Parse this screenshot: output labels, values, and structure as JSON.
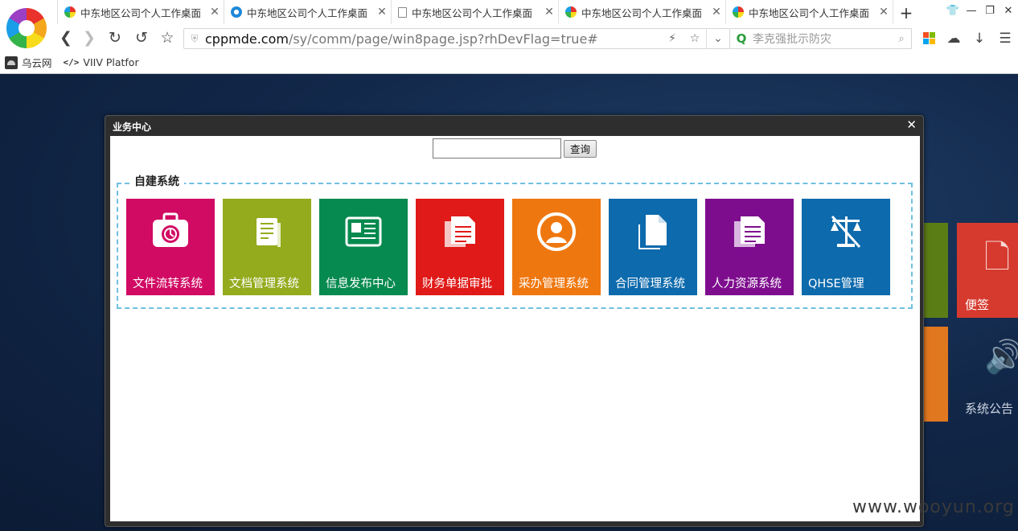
{
  "browser": {
    "tabs": [
      {
        "label": "中东地区公司个人工作桌面",
        "icon": "color",
        "active": true
      },
      {
        "label": "中东地区公司个人工作桌面",
        "icon": "blue"
      },
      {
        "label": "中东地区公司个人工作桌面",
        "icon": "doc"
      },
      {
        "label": "中东地区公司个人工作桌面",
        "icon": "color"
      },
      {
        "label": "中东地区公司个人工作桌面",
        "icon": "color"
      }
    ],
    "url_domain": "cppmde.com",
    "url_path": "/sy/comm/page/win8page.jsp?rhDevFlag=true#",
    "search_placeholder": "李克强批示防灾",
    "bookmarks": [
      {
        "label": "乌云网",
        "icon": "wooyun-icon"
      },
      {
        "label": "VIIV Platfor",
        "icon": "code-icon"
      }
    ]
  },
  "background_tiles": [
    {
      "label": "便签",
      "color": "#d63a2f"
    },
    {
      "label": "系统公告",
      "color": "#e0781f"
    }
  ],
  "dialog": {
    "title": "业务中心",
    "close_glyph": "✕",
    "search": {
      "value": "",
      "button_label": "查询"
    },
    "section": {
      "legend": "自建系统",
      "tiles": [
        {
          "label": "文件流转系统",
          "color": "#d10a63",
          "icon": "briefcase-icon"
        },
        {
          "label": "文档管理系统",
          "color": "#93ab1d",
          "icon": "document-icon"
        },
        {
          "label": "信息发布中心",
          "color": "#078a4f",
          "icon": "newspaper-icon"
        },
        {
          "label": "财务单据审批",
          "color": "#df1a18",
          "icon": "papers-icon"
        },
        {
          "label": "采办管理系统",
          "color": "#ef7710",
          "icon": "user-circle-icon"
        },
        {
          "label": "合同管理系统",
          "color": "#0d6aac",
          "icon": "file-stack-icon"
        },
        {
          "label": "人力资源系统",
          "color": "#7e0d8e",
          "icon": "papers-icon"
        },
        {
          "label": "QHSE管理",
          "color": "#0d6aac",
          "icon": "scale-icon"
        }
      ]
    }
  },
  "watermark": "www.wooyun.org"
}
